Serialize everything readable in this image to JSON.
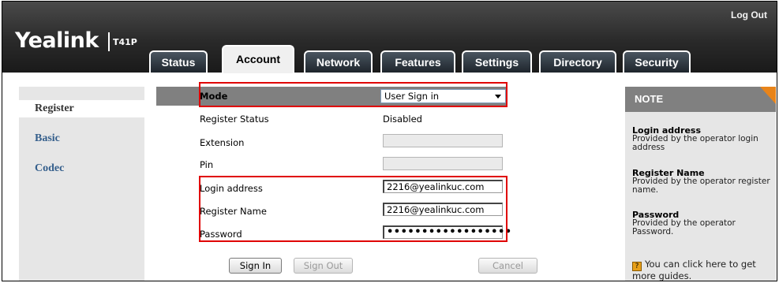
{
  "header": {
    "logo_text": "Yealink",
    "model": "T41P",
    "logout_label": "Log Out"
  },
  "tabs": [
    {
      "label": "Status"
    },
    {
      "label": "Account",
      "active": true
    },
    {
      "label": "Network"
    },
    {
      "label": "Features"
    },
    {
      "label": "Settings"
    },
    {
      "label": "Directory"
    },
    {
      "label": "Security"
    }
  ],
  "sidebar": {
    "items": [
      {
        "label": "Register",
        "active": true
      },
      {
        "label": "Basic"
      },
      {
        "label": "Codec"
      }
    ]
  },
  "form": {
    "mode": {
      "label": "Mode",
      "value": "User Sign in"
    },
    "register_status": {
      "label": "Register Status",
      "value": "Disabled"
    },
    "extension": {
      "label": "Extension",
      "value": ""
    },
    "pin": {
      "label": "Pin",
      "value": ""
    },
    "login_address": {
      "label": "Login address",
      "value": "2216@yealinkuc.com"
    },
    "register_name": {
      "label": "Register Name",
      "value": "2216@yealinkuc.com"
    },
    "password": {
      "label": "Password",
      "value": "••••••••••••••••••"
    }
  },
  "buttons": {
    "sign_in": "Sign In",
    "sign_out": "Sign Out",
    "cancel": "Cancel"
  },
  "note": {
    "title": "NOTE",
    "items": [
      {
        "heading": "Login address",
        "text": "Provided by the operator login address"
      },
      {
        "heading": "Register Name",
        "text": "Provided by the operator register name."
      },
      {
        "heading": "Password",
        "text": "Provided by the operator Password."
      }
    ],
    "help_text": "You can click here to get more guides."
  },
  "colors": {
    "highlight_box": "#e00000",
    "nav_link": "#355f8c",
    "note_corner": "#e8841a"
  }
}
